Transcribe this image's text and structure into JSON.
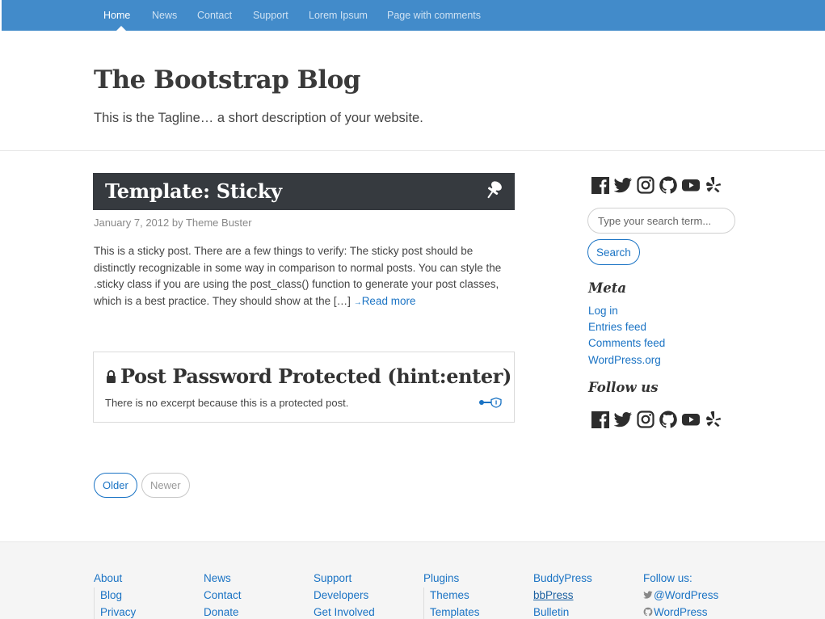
{
  "nav": {
    "items": [
      {
        "label": "Home"
      },
      {
        "label": "News"
      },
      {
        "label": "Contact"
      },
      {
        "label": "Support"
      },
      {
        "label": "Lorem Ipsum"
      },
      {
        "label": "Page with comments"
      }
    ]
  },
  "header": {
    "site_title": "The Bootstrap Blog",
    "tagline": "This is the Tagline… a short description of your website."
  },
  "posts": {
    "sticky": {
      "title": "Template: Sticky",
      "meta": "January 7, 2012 by Theme Buster",
      "excerpt": "This is a sticky post. There are a few things to verify: The sticky post should be distinctly recognizable in some way in comparison to normal posts. You can style the .sticky class if you are using the post_class() function to generate your post classes, which is a best practice. They should show at the […]",
      "read_more": "Read more",
      "read_more_arrow": "→"
    },
    "protected": {
      "title": "Post Password Protected (hint:enter)",
      "excerpt": "There is no excerpt because this is a protected post."
    }
  },
  "pager": {
    "older": "Older",
    "newer": "Newer"
  },
  "sidebar": {
    "social_icons": [
      "facebook-icon",
      "twitter-icon",
      "instagram-icon",
      "github-icon",
      "youtube-icon",
      "yelp-icon"
    ],
    "search": {
      "placeholder": "Type your search term...",
      "button": "Search"
    },
    "meta": {
      "title": "Meta",
      "links": [
        "Log in",
        "Entries feed",
        "Comments feed",
        "WordPress.org"
      ]
    },
    "follow": {
      "title": "Follow us"
    }
  },
  "footer": {
    "columns": [
      {
        "head": "About",
        "links": [
          "Blog",
          "Privacy"
        ]
      },
      {
        "head": "News",
        "links": [
          "Contact",
          "Donate"
        ]
      },
      {
        "head": "Support",
        "links": [
          "Developers",
          "Get Involved"
        ]
      },
      {
        "head": "Plugins",
        "links": [
          "Themes",
          "Templates"
        ]
      },
      {
        "head": "BuddyPress",
        "links": [
          "bbPress",
          "Bulletin"
        ]
      },
      {
        "head": "Follow us:",
        "links": [
          "@WordPress",
          "WordPress"
        ]
      }
    ]
  },
  "colors": {
    "nav_bg": "#428bca",
    "link": "#1a73c4",
    "sticky_bg": "#363a3f",
    "footer_bg": "#f5f5f5"
  }
}
